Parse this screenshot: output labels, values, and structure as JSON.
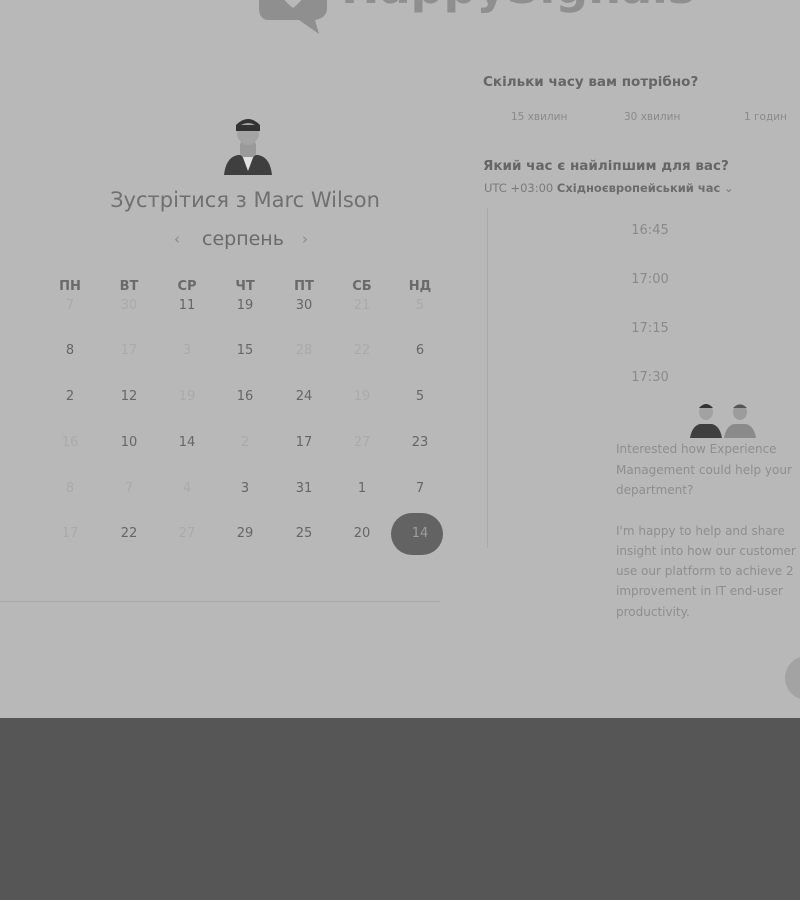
{
  "brand": {
    "name": "HappySignals"
  },
  "meeting": {
    "title": "Зустрітися з Marc Wilson",
    "month": "серпень",
    "prev_icon": "‹",
    "next_icon": "›"
  },
  "calendar": {
    "weekdays": [
      "ПН",
      "ВТ",
      "СР",
      "ЧТ",
      "ПТ",
      "СБ",
      "НД"
    ],
    "weeks": [
      [
        {
          "d": "7",
          "on": false
        },
        {
          "d": "30",
          "on": false
        },
        {
          "d": "11",
          "on": true
        },
        {
          "d": "19",
          "on": true
        },
        {
          "d": "30",
          "on": true
        },
        {
          "d": "21",
          "on": false
        },
        {
          "d": "5",
          "on": false
        }
      ],
      [
        {
          "d": "8",
          "on": true
        },
        {
          "d": "17",
          "on": false
        },
        {
          "d": "3",
          "on": false
        },
        {
          "d": "15",
          "on": true
        },
        {
          "d": "28",
          "on": false
        },
        {
          "d": "22",
          "on": false
        },
        {
          "d": "6",
          "on": true
        }
      ],
      [
        {
          "d": "2",
          "on": true
        },
        {
          "d": "12",
          "on": true
        },
        {
          "d": "19",
          "on": false
        },
        {
          "d": "16",
          "on": true
        },
        {
          "d": "24",
          "on": true
        },
        {
          "d": "19",
          "on": false
        },
        {
          "d": "5",
          "on": true
        }
      ],
      [
        {
          "d": "16",
          "on": false
        },
        {
          "d": "10",
          "on": true
        },
        {
          "d": "14",
          "on": true
        },
        {
          "d": "2",
          "on": false
        },
        {
          "d": "17",
          "on": true
        },
        {
          "d": "27",
          "on": false
        },
        {
          "d": "23",
          "on": true
        }
      ],
      [
        {
          "d": "8",
          "on": false
        },
        {
          "d": "7",
          "on": false
        },
        {
          "d": "4",
          "on": false
        },
        {
          "d": "3",
          "on": true
        },
        {
          "d": "31",
          "on": true
        },
        {
          "d": "1",
          "on": true
        },
        {
          "d": "7",
          "on": true
        }
      ],
      [
        {
          "d": "17",
          "on": false
        },
        {
          "d": "22",
          "on": true
        },
        {
          "d": "27",
          "on": false
        },
        {
          "d": "29",
          "on": true
        },
        {
          "d": "25",
          "on": true
        },
        {
          "d": "20",
          "on": true
        },
        {
          "d": "14",
          "on": true,
          "selected": true
        }
      ]
    ]
  },
  "duration": {
    "question": "Скільки часу вам потрібно?",
    "options": [
      "15 хвилин",
      "30 хвилин",
      "1 годин"
    ]
  },
  "time": {
    "question": "Який час є найліпшим для вас?",
    "tz_offset": "UTC +03:00",
    "tz_name": "Східноєвропейський час",
    "tz_caret": "⌄",
    "slots": [
      "16:45",
      "17:00",
      "17:15",
      "17:30"
    ]
  },
  "chat": {
    "lines": [
      "Interested how Experience",
      "Management could help your",
      "department?",
      "",
      "I'm happy to help and share",
      "insight into how our customer",
      "use our platform to achieve 2",
      "improvement in IT end-user",
      "productivity."
    ]
  },
  "colors": {
    "overlay": "#b8b8b8",
    "footer": "#565656",
    "selected": "#636363"
  }
}
